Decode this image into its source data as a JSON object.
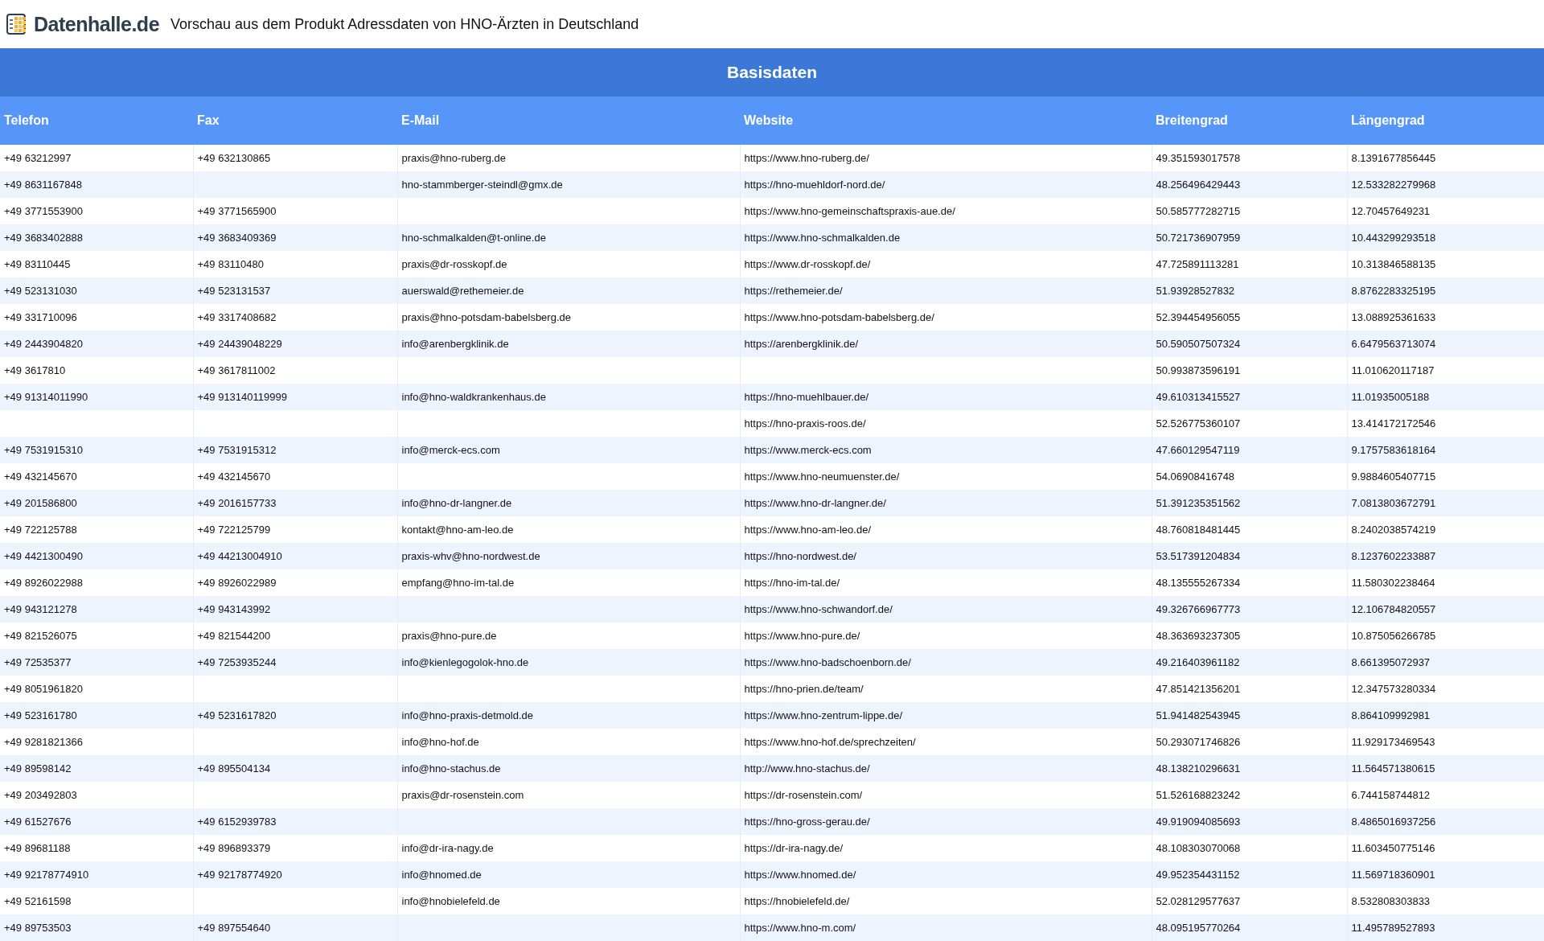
{
  "header": {
    "logo_text": "Datenhalle.de",
    "title": "Vorschau aus dem Produkt Adressdaten von HNO-Ärzten in Deutschland"
  },
  "table": {
    "group_title": "Basisdaten",
    "columns": [
      "Telefon",
      "Fax",
      "E-Mail",
      "Website",
      "Breitengrad",
      "Längengrad"
    ],
    "rows": [
      [
        "+49 63212997",
        "+49 632130865",
        "praxis@hno-ruberg.de",
        "https://www.hno-ruberg.de/",
        "49.351593017578",
        "8.1391677856445"
      ],
      [
        "+49 8631167848",
        null,
        "hno-stammberger-steindl@gmx.de",
        "https://hno-muehldorf-nord.de/",
        "48.256496429443",
        "12.533282279968"
      ],
      [
        "+49 3771553900",
        "+49 3771565900",
        null,
        "https://www.hno-gemeinschaftspraxis-aue.de/",
        "50.585777282715",
        "12.70457649231"
      ],
      [
        "+49 3683402888",
        "+49 3683409369",
        "hno-schmalkalden@t-online.de",
        "https://www.hno-schmalkalden.de",
        "50.721736907959",
        "10.443299293518"
      ],
      [
        "+49 83110445",
        "+49 83110480",
        "praxis@dr-rosskopf.de",
        "https://www.dr-rosskopf.de/",
        "47.725891113281",
        "10.313846588135"
      ],
      [
        "+49 523131030",
        "+49 523131537",
        "auerswald@rethemeier.de",
        "https://rethemeier.de/",
        "51.93928527832",
        "8.8762283325195"
      ],
      [
        "+49 331710096",
        "+49 3317408682",
        "praxis@hno-potsdam-babelsberg.de",
        "https://www.hno-potsdam-babelsberg.de/",
        "52.394454956055",
        "13.088925361633"
      ],
      [
        "+49 2443904820",
        "+49 24439048229",
        "info@arenbergklinik.de",
        "https://arenbergklinik.de/",
        "50.590507507324",
        "6.6479563713074"
      ],
      [
        "+49 3617810",
        "+49 3617811002",
        null,
        null,
        "50.993873596191",
        "11.010620117187"
      ],
      [
        "+49 91314011990",
        "+49 913140119999",
        "info@hno-waldkrankenhaus.de",
        "https://hno-muehlbauer.de/",
        "49.610313415527",
        "11.01935005188"
      ],
      [
        null,
        null,
        null,
        "https://hno-praxis-roos.de/",
        "52.526775360107",
        "13.414172172546"
      ],
      [
        "+49 7531915310",
        "+49 7531915312",
        "info@merck-ecs.com",
        "https://www.merck-ecs.com",
        "47.660129547119",
        "9.1757583618164"
      ],
      [
        "+49 432145670",
        "+49 432145670",
        null,
        "https://www.hno-neumuenster.de/",
        "54.06908416748",
        "9.9884605407715"
      ],
      [
        "+49 201586800",
        "+49 2016157733",
        "info@hno-dr-langner.de",
        "https://www.hno-dr-langner.de/",
        "51.391235351562",
        "7.0813803672791"
      ],
      [
        "+49 722125788",
        "+49 722125799",
        "kontakt@hno-am-leo.de",
        "https://www.hno-am-leo.de/",
        "48.760818481445",
        "8.2402038574219"
      ],
      [
        "+49 4421300490",
        "+49 44213004910",
        "praxis-whv@hno-nordwest.de",
        "https://hno-nordwest.de/",
        "53.517391204834",
        "8.1237602233887"
      ],
      [
        "+49 8926022988",
        "+49 8926022989",
        "empfang@hno-im-tal.de",
        "https://hno-im-tal.de/",
        "48.135555267334",
        "11.580302238464"
      ],
      [
        "+49 943121278",
        "+49 943143992",
        null,
        "https://www.hno-schwandorf.de/",
        "49.326766967773",
        "12.106784820557"
      ],
      [
        "+49 821526075",
        "+49 821544200",
        "praxis@hno-pure.de",
        "https://www.hno-pure.de/",
        "48.363693237305",
        "10.875056266785"
      ],
      [
        "+49 72535377",
        "+49 7253935244",
        "info@kienlegogolok-hno.de",
        "https://www.hno-badschoenborn.de/",
        "49.216403961182",
        "8.661395072937"
      ],
      [
        "+49 8051961820",
        null,
        null,
        "https://hno-prien.de/team/",
        "47.851421356201",
        "12.347573280334"
      ],
      [
        "+49 523161780",
        "+49 5231617820",
        "info@hno-praxis-detmold.de",
        "https://www.hno-zentrum-lippe.de/",
        "51.941482543945",
        "8.864109992981"
      ],
      [
        "+49 9281821366",
        null,
        "info@hno-hof.de",
        "https://www.hno-hof.de/sprechzeiten/",
        "50.293071746826",
        "11.929173469543"
      ],
      [
        "+49 89598142",
        "+49 895504134",
        "info@hno-stachus.de",
        "http://www.hno-stachus.de/",
        "48.138210296631",
        "11.564571380615"
      ],
      [
        "+49 203492803",
        null,
        "praxis@dr-rosenstein.com",
        "https://dr-rosenstein.com/",
        "51.526168823242",
        "6.744158744812"
      ],
      [
        "+49 61527676",
        "+49 6152939783",
        null,
        "https://hno-gross-gerau.de/",
        "49.919094085693",
        "8.4865016937256"
      ],
      [
        "+49 89681188",
        "+49 896893379",
        "info@dr-ira-nagy.de",
        "https://dr-ira-nagy.de/",
        "48.108303070068",
        "11.603450775146"
      ],
      [
        "+49 92178774910",
        "+49 92178774920",
        "info@hnomed.de",
        "https://www.hnomed.de/",
        "49.952354431152",
        "11.569718360901"
      ],
      [
        "+49 52161598",
        null,
        "info@hnobielefeld.de",
        "https://hnobielefeld.de/",
        "52.028129577637",
        "8.532808303833"
      ],
      [
        "+49 89753503",
        "+49 897554640",
        null,
        "https://www.hno-m.com/",
        "48.095195770264",
        "11.495789527893"
      ]
    ]
  }
}
